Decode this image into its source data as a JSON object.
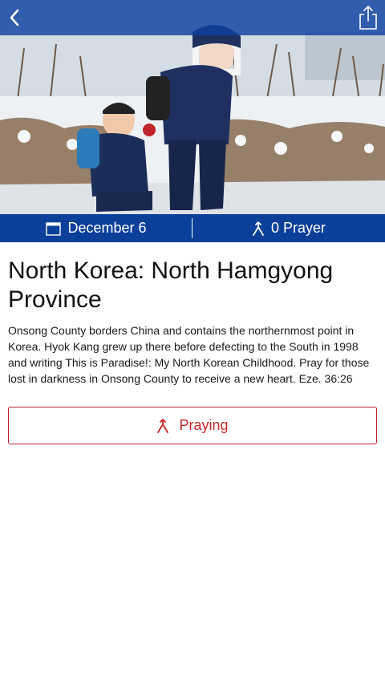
{
  "colors": {
    "nav_bg": "#0e40a0",
    "info_bar_bg": "#0a3f9a",
    "accent_red": "#c62828",
    "text": "#111111"
  },
  "navbar": {
    "back_icon": "chevron-left-icon",
    "share_icon": "share-icon"
  },
  "hero": {
    "image": "photo of two children in winter coats on a snowy road"
  },
  "info_bar": {
    "date_icon": "calendar-icon",
    "date": "December 6",
    "prayer_icon": "praying-hands-icon",
    "prayer_count": "0 Prayer"
  },
  "content": {
    "title": "North Korea: North Hamgyong Province",
    "description": "Onsong County borders China and contains the northernmost point in Korea. Hyok Kang grew up there before defecting to the South in 1998 and writing This is Paradise!: My North Korean Childhood. Pray for those lost in darkness in Onsong County to receive a new heart. Eze. 36:26"
  },
  "action": {
    "pray_icon": "praying-hands-icon",
    "label": "Praying"
  }
}
